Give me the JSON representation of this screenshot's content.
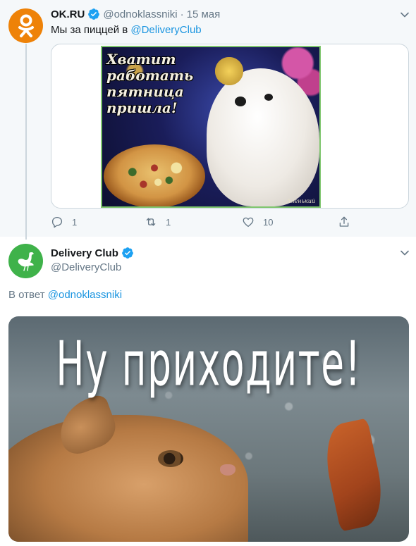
{
  "tweet1": {
    "name": "OK.RU",
    "handle": "@odnoklassniki",
    "separator": "·",
    "date": "15 мая",
    "text_prefix": "Мы за пиццей в ",
    "text_link": "@DeliveryClub",
    "image_text": "Хватит работать пятница пришла!",
    "image_signature": "Аленький",
    "actions": {
      "reply_count": "1",
      "retweet_count": "1",
      "like_count": "10"
    },
    "avatar_color": "#ee8208"
  },
  "tweet2": {
    "name": "Delivery Club",
    "handle": "@DeliveryClub",
    "reply_prefix": "В ответ ",
    "reply_link": "@odnoklassniki",
    "image_text": "Ну приходите!",
    "avatar_color": "#3fb24a"
  },
  "colors": {
    "accent": "#1b95e0",
    "verified": "#1da1f2",
    "secondary_text": "#657786"
  },
  "icons": [
    "ok-logo-icon",
    "verified-icon",
    "chevron-down-icon",
    "reply-icon",
    "retweet-icon",
    "like-icon",
    "share-icon",
    "ostrich-logo-icon"
  ]
}
